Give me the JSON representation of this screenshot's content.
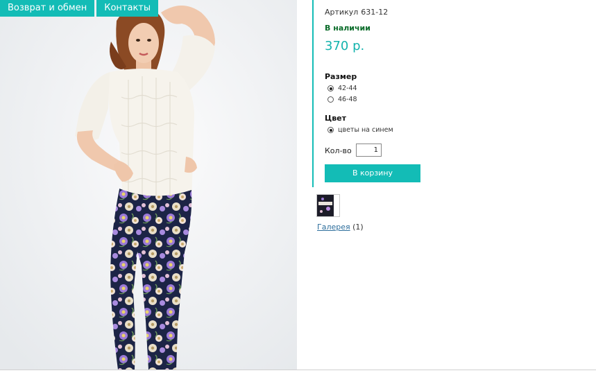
{
  "topnav": {
    "items": [
      "Возврат и обмен",
      "Контакты"
    ],
    "accent": "#13bcb6"
  },
  "product": {
    "sku_label": "Артикул",
    "sku": "631-12",
    "stock": "В наличии",
    "price": "370 р.",
    "size_title": "Размер",
    "sizes": [
      {
        "label": "42-44",
        "selected": true
      },
      {
        "label": "46-48",
        "selected": false
      }
    ],
    "color_title": "Цвет",
    "colors": [
      {
        "label": "цветы на синем",
        "selected": true
      }
    ],
    "qty_label": "Кол-во",
    "qty_value": "1",
    "cart_button": "В корзину"
  },
  "gallery": {
    "link_text": "Галерея",
    "count": "(1)"
  },
  "colors": {
    "accent": "#13bcb6",
    "price": "#13b3ad",
    "stock": "#0b6c2a",
    "link": "#2d6e9c"
  }
}
